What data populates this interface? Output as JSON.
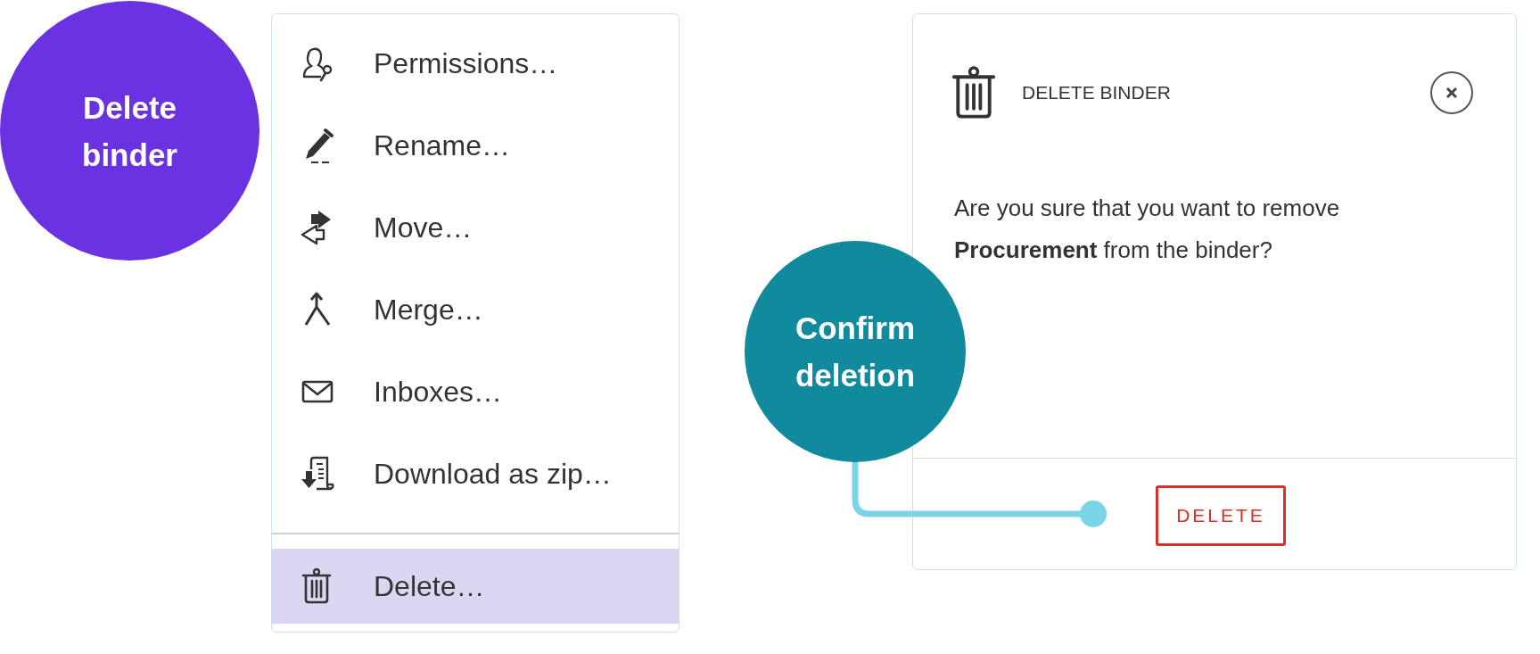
{
  "callouts": [
    {
      "text": "Delete binder",
      "color": "#6a32e0"
    },
    {
      "text": "Confirm deletion",
      "color": "#128a9e"
    }
  ],
  "menu": {
    "sections": [
      {
        "items": [
          {
            "label": "Permissions…",
            "selected": false
          },
          {
            "label": "Rename…",
            "selected": false
          },
          {
            "label": "Move…",
            "selected": false
          },
          {
            "label": "Merge…",
            "selected": false
          },
          {
            "label": "Inboxes…",
            "selected": false
          },
          {
            "label": "Download as zip…",
            "selected": false
          }
        ]
      },
      {
        "items": [
          {
            "label": "Delete…",
            "selected": true
          }
        ]
      }
    ]
  },
  "dialog": {
    "title": "DELETE BINDER",
    "message": "Are you sure that you want to remove **Procurement** from the binder?",
    "button": "DELETE"
  }
}
